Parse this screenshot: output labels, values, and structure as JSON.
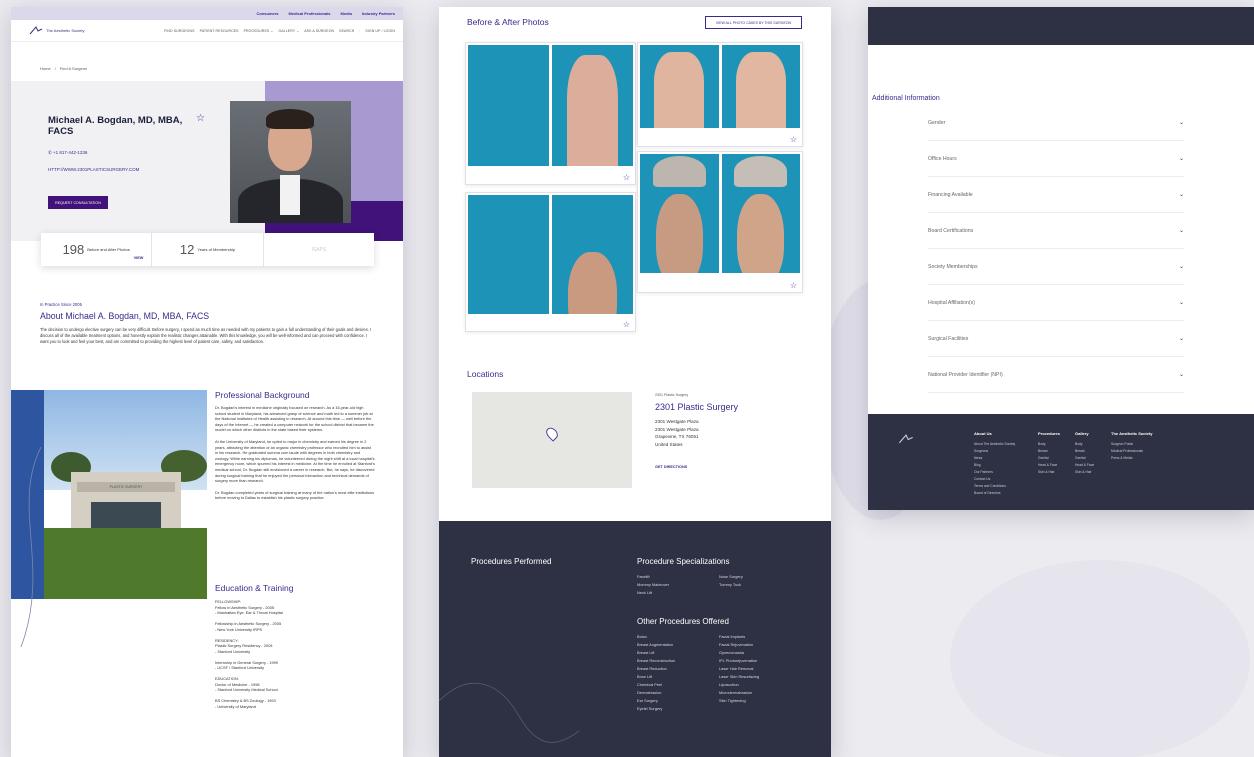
{
  "top_links": [
    "Consumers",
    "Medical Professionals",
    "Media",
    "Industry Partners"
  ],
  "logo_text": "The Aesthetic Society",
  "nav": [
    "FIND SURGEONS",
    "PATIENT RESOURCES",
    "PROCEDURES ⌄",
    "GALLERY ⌄",
    "ASK A SURGEON",
    "SEARCH",
    "SIGN UP / LOGIN"
  ],
  "breadcrumb": {
    "home": "Home",
    "sep": "/",
    "current": "Find A Surgeon"
  },
  "profile": {
    "name": "Michael A. Bogdan, MD, MBA, FACS",
    "phone": "+1 817-442-1236",
    "website": "HTTP://WWW.2301PLASTICSURGERY.COM",
    "request_btn": "REQUEST CONSULTATION"
  },
  "stats": {
    "photos_num": "198",
    "photos_label": "Before and After Photos",
    "photos_view": "VIEW",
    "years_num": "12",
    "years_label": "Years of Membership",
    "badge": "ISAPS"
  },
  "about": {
    "since": "In Practice Since 2005",
    "title": "About Michael A. Bogdan, MD, MBA, FACS",
    "body": "The decision to undergo elective surgery can be very difficult. Before surgery, I spend as much time as needed with my patients to gain a full understanding of their goals and desires. I discuss all of the available treatment options, and honestly explain the realistic changes attainable. With this knowledge, you will be well-informed and can proceed with confidence. I want you to look and feel your best, and am committed to providing the highest level of patient care, safety, and satisfaction."
  },
  "building_sign": "PLASTIC SURGERY",
  "background": {
    "title": "Professional Background",
    "p1": "Dr. Bogdan's interest in medicine originally focused on research. As a 16-year-old high school student in Maryland, his advanced grasp of science and math led to a summer job at the National Institutes of Health assisting in research. At around this time — well before the days of the Internet — he created a computer network for the school district that became the model on which other districts in the state based their systems.",
    "p2": "At the University of Maryland, he opted to major in chemistry and earned his degree in 2 years, attracting the attention of an organic chemistry professor who recruited him to assist in his research. He graduated summa cum laude with degrees in both chemistry and zoology. While earning his diplomas, he volunteered during the night shift at a local hospital's emergency room, which spurred his interest in medicine. At the time he enrolled at Stanford's medical school, Dr. Bogdan still envisioned a career in research. But, he says, he discovered during surgical training that he enjoyed the personal interaction and technical demands of surgery more than research.",
    "p3": "Dr. Bogdan completed years of surgical training at many of the nation's most elite institutions before moving to Dallas to establish his plastic surgery practice."
  },
  "education": {
    "title": "Education & Training",
    "items": [
      "FELLOWSHIP:\nFellow in Aesthetic Surgery - 2005\n- Manhattan Eye, Ear & Throat Hospital",
      "Fellowship in Aesthetic Surgery - 2005\n- New York University IRPS",
      "RESIDENCY:\nPlastic Surgery Residency - 2004\n- Stanford University",
      "Internship in General Surgery - 1999\n- UCSF / Stanford University",
      "EDUCATION:\nDoctor of Medicine - 1998\n- Stanford University Medical School",
      "BS Chemistry & BS Zoology - 1993\n- University of Maryland"
    ]
  },
  "gallery": {
    "title": "Before & After Photos",
    "view_all": "VIEW ALL PHOTO CASES BY THIS SURGEON"
  },
  "locations": {
    "title": "Locations",
    "small": "2301 Plastic Surgery",
    "name": "2301 Plastic Surgery",
    "addr1": "2301 Westgate Plaza",
    "addr2": "2301 Westgate Plaza",
    "addr3": "Grapevine, TX 76051",
    "addr4": "United States",
    "directions": "GET DIRECTIONS"
  },
  "procedures": {
    "performed": "Procedures Performed",
    "spec_title": "Procedure Specializations",
    "spec": [
      "Facelift",
      "Nose Surgery",
      "Mommy Makeover",
      "Tummy Tuck",
      "Neck Lift"
    ],
    "other_title": "Other Procedures Offered",
    "other": [
      "Botox",
      "Facial Implants",
      "Breast Augmentation",
      "Facial Rejuvenation",
      "Breast Lift",
      "Gynecomastia",
      "Breast Reconstruction",
      "IPL Photorejuvenation",
      "Breast Reduction",
      "Laser Hair Removal",
      "Brow Lift",
      "Laser Skin Resurfacing",
      "Chemical Peel",
      "Liposuction",
      "Dermabrasion",
      "Microdermabrasion",
      "Ear Surgery",
      "Skin Tightening",
      "Eyelid Surgery"
    ]
  },
  "additional": {
    "title": "Additional Information",
    "items": [
      "Gender",
      "Office Hours",
      "Financing Available",
      "Board Certifications",
      "Society Memberships",
      "Hospital Affiliation(s)",
      "Surgical Facilities",
      "National Provider Identifier (NPI)"
    ]
  },
  "footer": {
    "about": {
      "title": "About Us",
      "items": [
        "About The Aesthetic Society",
        "Surgeons",
        "News",
        "Blog",
        "Our Partners",
        "Contact Us",
        "Terms and Conditions",
        "Board of Directors"
      ]
    },
    "procedures": {
      "title": "Procedures",
      "items": [
        "Body",
        "Breast",
        "Genital",
        "Head & Face",
        "Skin & Hair"
      ]
    },
    "gallery": {
      "title": "Gallery",
      "items": [
        "Body",
        "Breast",
        "Genital",
        "Head & Face",
        "Skin & Hair"
      ]
    },
    "society": {
      "title": "The Aesthetic Society",
      "items": [
        "Surgeon Portal",
        "Medical Professionals",
        "Press & Media"
      ]
    }
  }
}
